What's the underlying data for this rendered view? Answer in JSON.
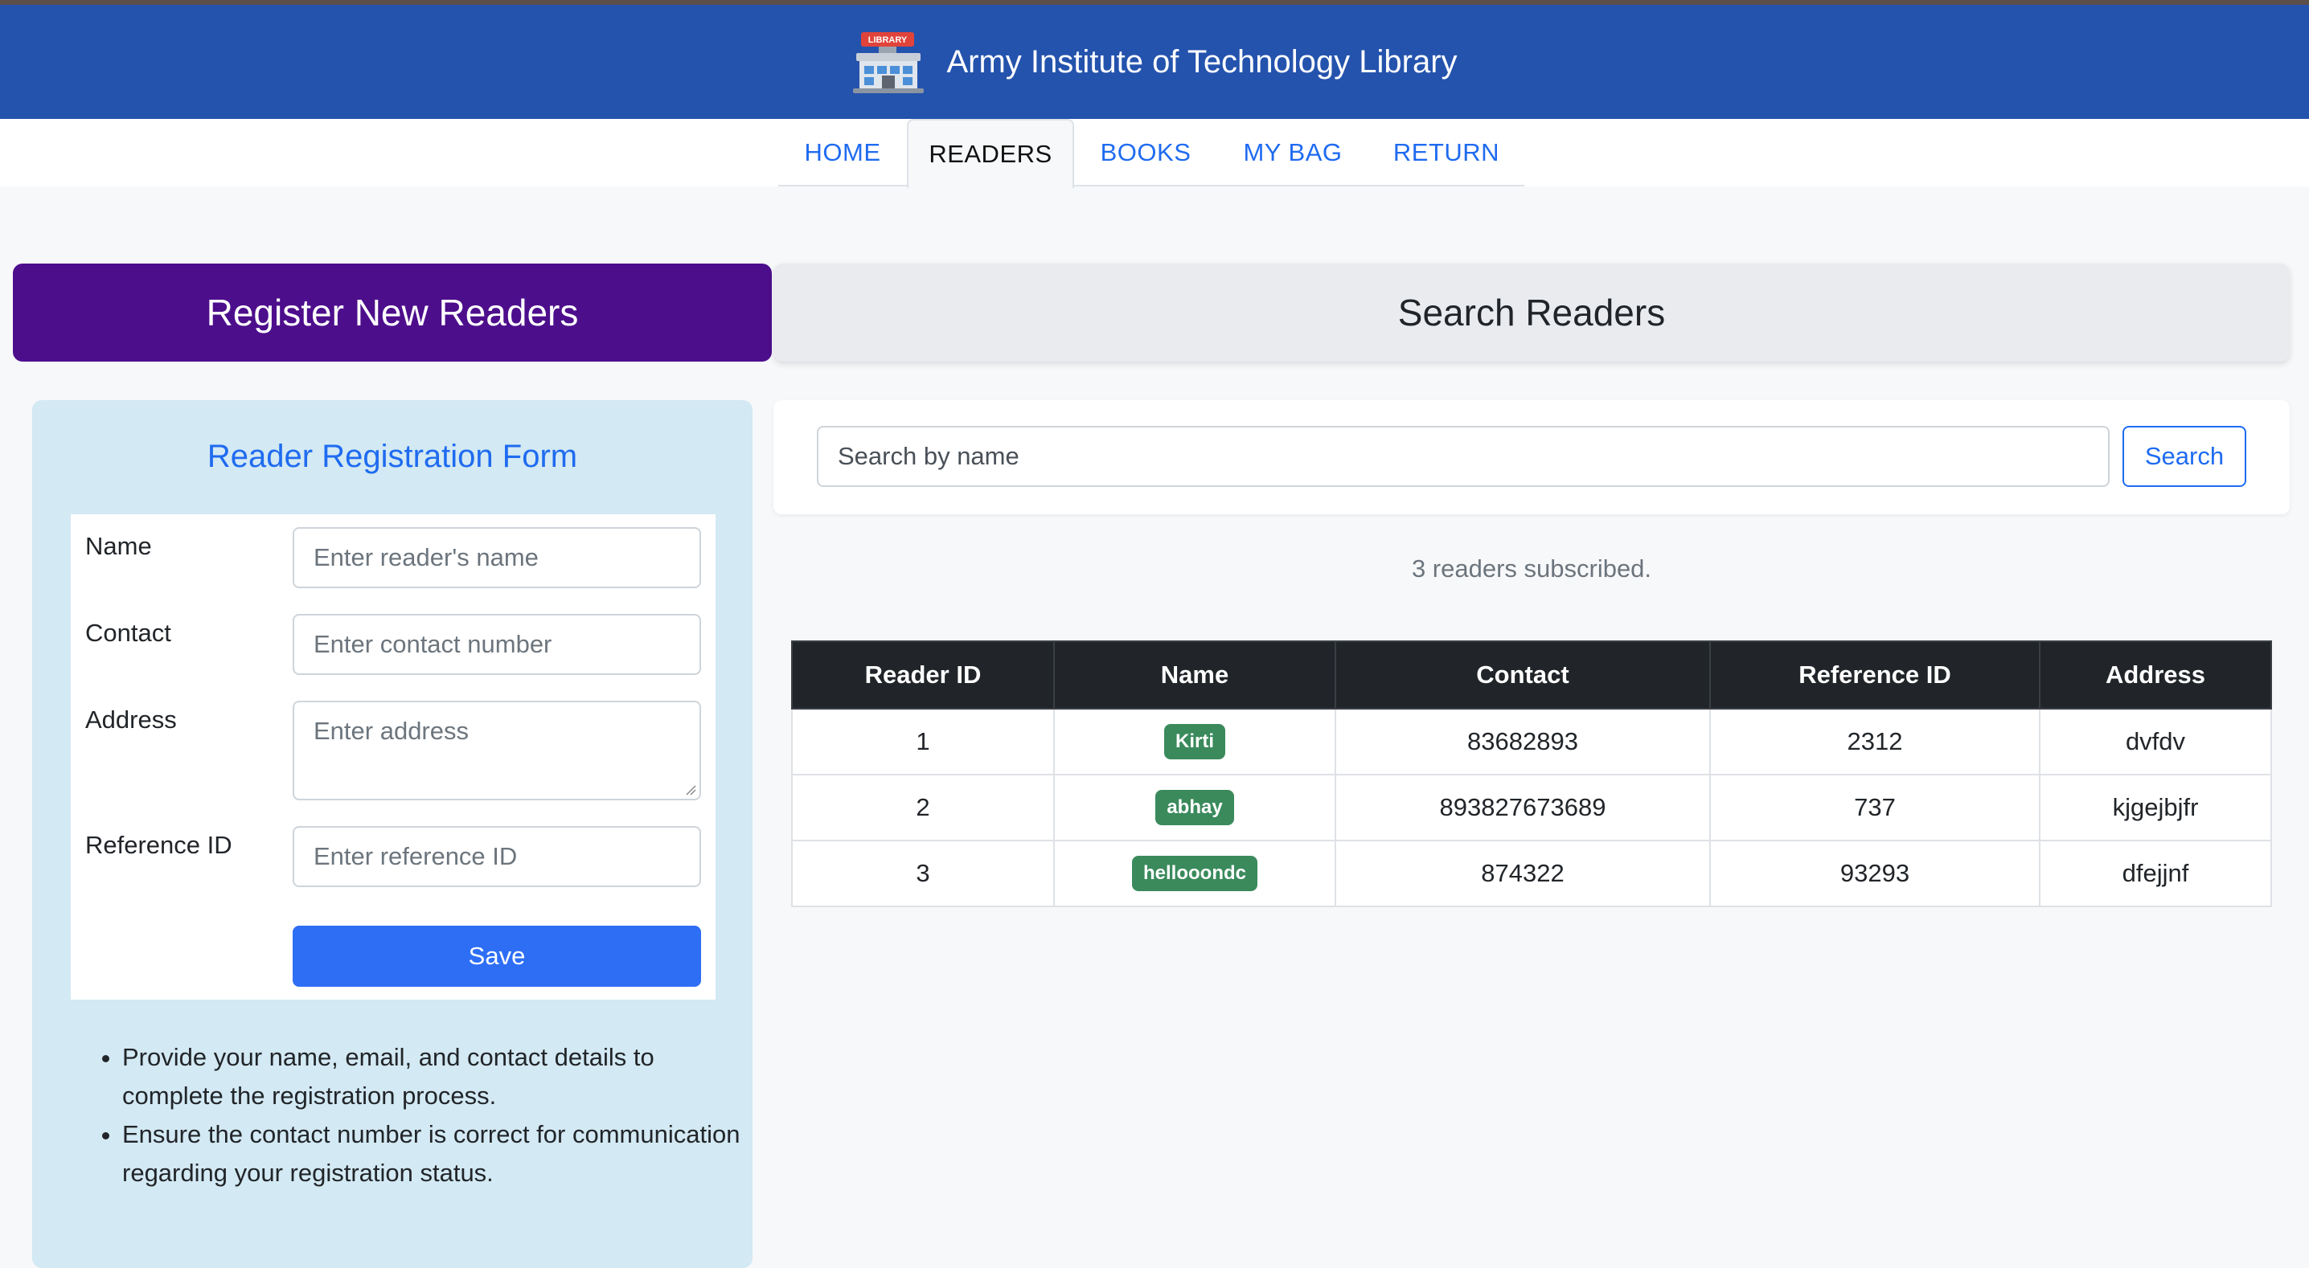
{
  "header": {
    "title": "Army Institute of Technology Library",
    "logo_text": "LIBRARY",
    "colors": {
      "header_bg": "#2453ad",
      "accent": "#1f6bf0"
    }
  },
  "nav": {
    "tabs": [
      {
        "label": "HOME",
        "active": false
      },
      {
        "label": "READERS",
        "active": true
      },
      {
        "label": "BOOKS",
        "active": false
      },
      {
        "label": "MY BAG",
        "active": false
      },
      {
        "label": "RETURN",
        "active": false
      }
    ]
  },
  "tabs": {
    "register": "Register New Readers",
    "search": "Search Readers"
  },
  "form": {
    "title": "Reader Registration Form",
    "fields": {
      "name": {
        "label": "Name",
        "placeholder": "Enter reader's name"
      },
      "contact": {
        "label": "Contact",
        "placeholder": "Enter contact number"
      },
      "address": {
        "label": "Address",
        "placeholder": "Enter address"
      },
      "reference": {
        "label": "Reference ID",
        "placeholder": "Enter reference ID"
      }
    },
    "save_label": "Save",
    "tips": [
      "Provide your name, email, and contact details to complete the registration process.",
      "Ensure the contact number is correct for communication regarding your registration status."
    ]
  },
  "search": {
    "placeholder": "Search by name",
    "button_label": "Search",
    "count_text": "3 readers subscribed."
  },
  "table": {
    "headers": [
      "Reader ID",
      "Name",
      "Contact",
      "Reference ID",
      "Address"
    ],
    "rows": [
      {
        "id": "1",
        "name": "Kirti",
        "contact": "83682893",
        "reference": "2312",
        "address": "dvfdv"
      },
      {
        "id": "2",
        "name": "abhay",
        "contact": "893827673689",
        "reference": "737",
        "address": "kjgejbjfr"
      },
      {
        "id": "3",
        "name": "hellooondc",
        "contact": "874322",
        "reference": "93293",
        "address": "dfejjnf"
      }
    ]
  }
}
